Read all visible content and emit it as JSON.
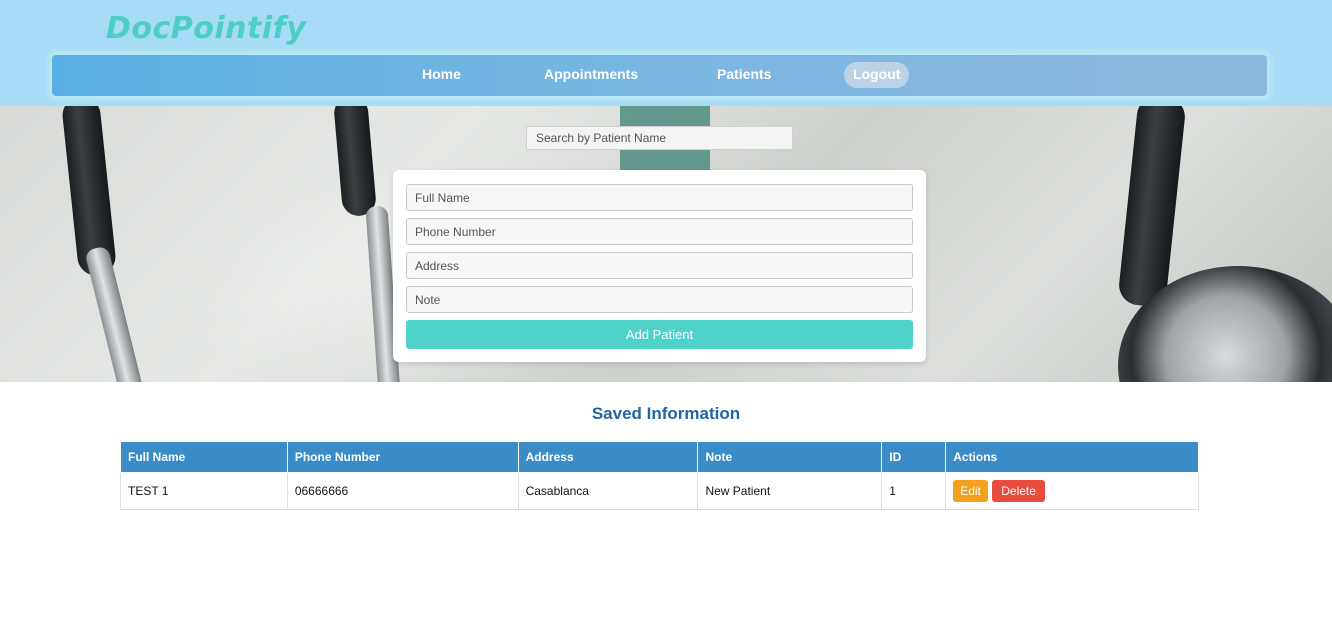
{
  "app": {
    "logo_text": "DocPointify"
  },
  "nav": {
    "items": [
      {
        "label": "Home"
      },
      {
        "label": "Appointments"
      },
      {
        "label": "Patients"
      },
      {
        "label": "Logout"
      }
    ]
  },
  "search": {
    "placeholder": "Search by Patient Name",
    "value": ""
  },
  "form": {
    "full_name_placeholder": "Full Name",
    "phone_placeholder": "Phone Number",
    "address_placeholder": "Address",
    "note_placeholder": "Note",
    "submit_label": "Add Patient"
  },
  "saved": {
    "title": "Saved Information",
    "columns": [
      "Full Name",
      "Phone Number",
      "Address",
      "Note",
      "ID",
      "Actions"
    ],
    "rows": [
      {
        "full_name": "TEST 1",
        "phone": "06666666",
        "address": "Casablanca",
        "note": "New Patient",
        "id": "1",
        "edit_label": "Edit",
        "delete_label": "Delete"
      }
    ]
  },
  "colors": {
    "header_bg": "#a6dcf6",
    "logo": "#4ecdc4",
    "add_button": "#4ed2c9",
    "table_header": "#3b8cc6",
    "edit_button": "#f2a01e",
    "delete_button": "#e74c3c",
    "section_title": "#1f66a3"
  }
}
